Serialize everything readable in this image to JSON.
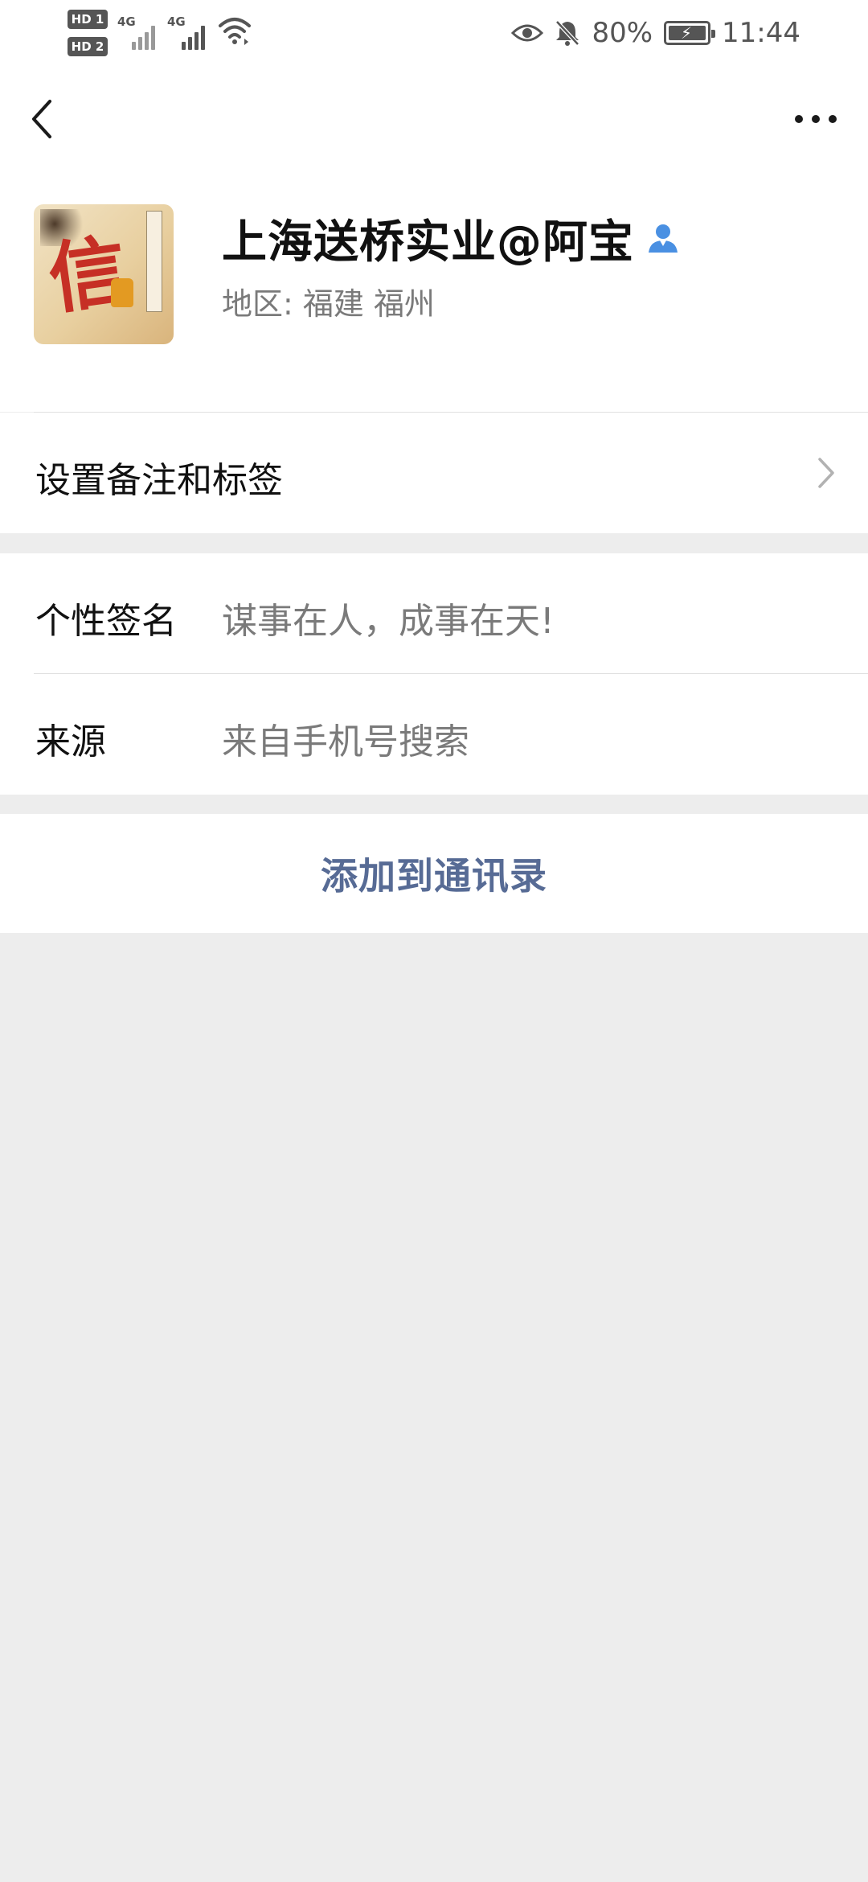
{
  "status_bar": {
    "sim1_badge": "HD 1",
    "sim2_badge": "HD 2",
    "sim1_network": "4G",
    "sim2_network": "4G",
    "battery_percent": "80%",
    "time": "11:44",
    "icons": [
      "eye-icon",
      "bell-off-icon",
      "wifi-icon",
      "battery-icon"
    ]
  },
  "nav": {
    "back_icon": "chevron-left-icon",
    "more_icon": "more-dots-icon"
  },
  "profile": {
    "display_name": "上海送桥实业@阿宝",
    "region": "地区:  福建  福州",
    "avatar_glyph": "信",
    "verified_icon": "person-icon",
    "verified_color": "#4a90e2"
  },
  "remark_row": {
    "label": "设置备注和标签"
  },
  "info": {
    "signature_label": "个性签名",
    "signature_value": "谋事在人，成事在天!",
    "source_label": "来源",
    "source_value": "来自手机号搜索"
  },
  "actions": {
    "add_to_contacts": "添加到通讯录",
    "link_color": "#576b95"
  }
}
